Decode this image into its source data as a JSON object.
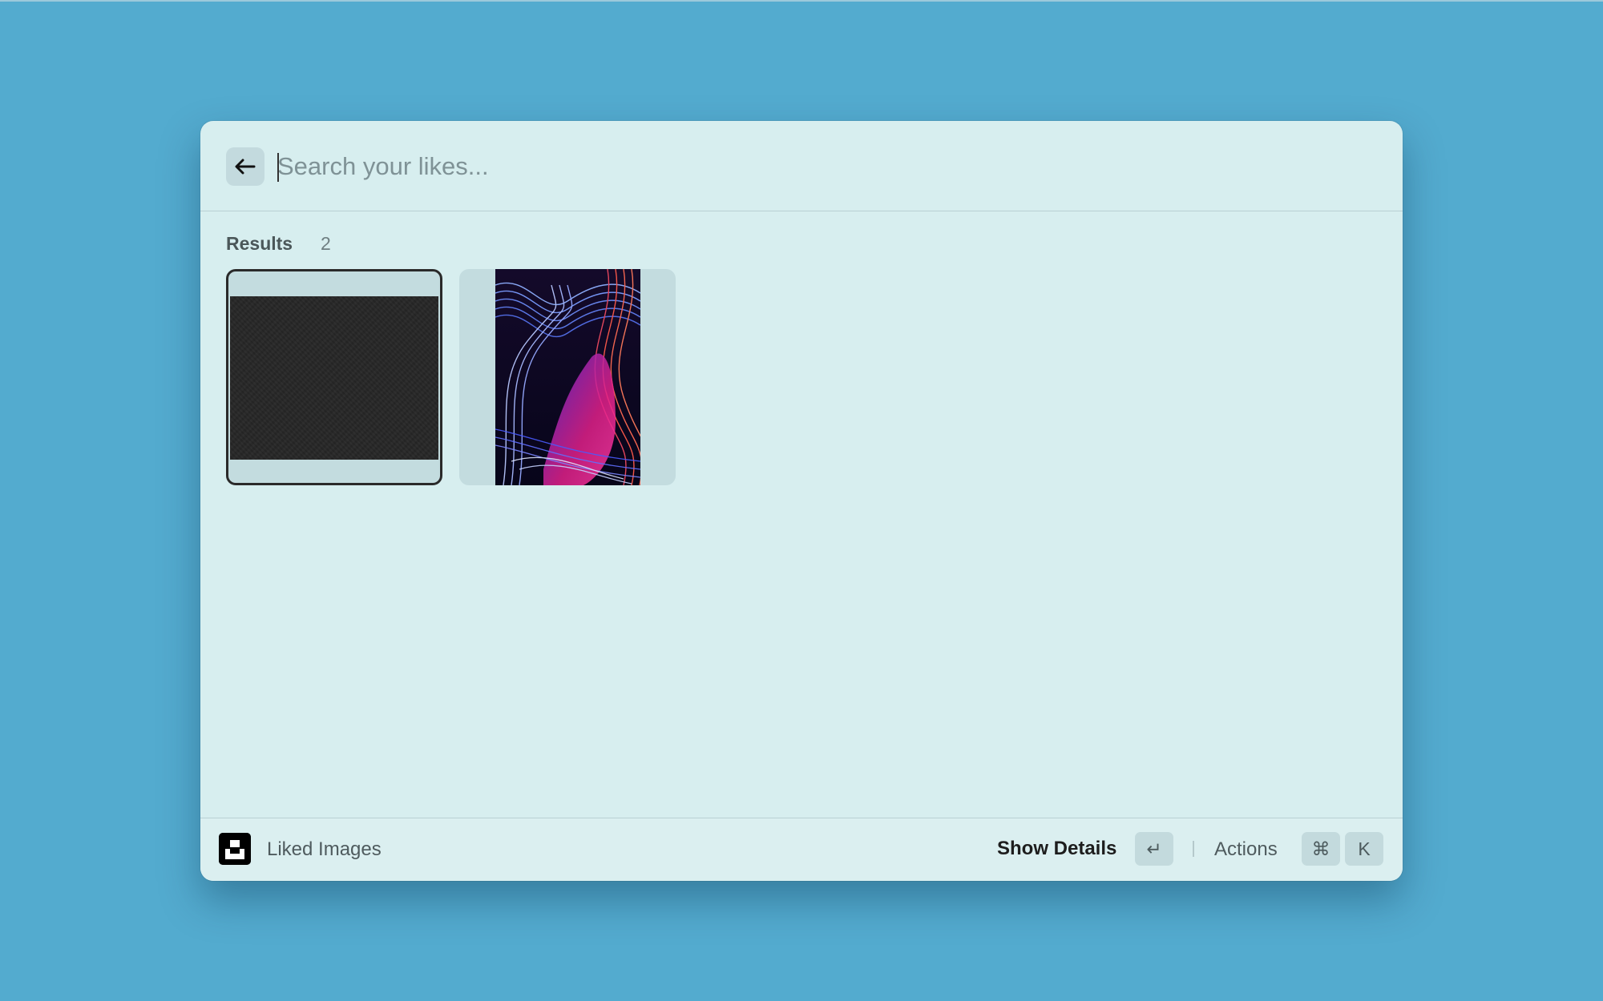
{
  "search": {
    "placeholder": "Search your likes...",
    "value": ""
  },
  "back_icon": "arrow-left-icon",
  "results": {
    "label": "Results",
    "count": "2",
    "items": [
      {
        "kind": "dark-textured-photo",
        "selected": true
      },
      {
        "kind": "light-painting-photo",
        "selected": false
      }
    ]
  },
  "footer": {
    "app_icon": "unsplash-icon",
    "app_name": "Liked Images",
    "primary_action": "Show Details",
    "enter_key": "↵",
    "secondary_action": "Actions",
    "cmd_key": "⌘",
    "k_key": "K"
  },
  "colors": {
    "desktop_background": "#53abcf",
    "window_background": "#d7eeef",
    "key_background": "#c3dadd"
  }
}
